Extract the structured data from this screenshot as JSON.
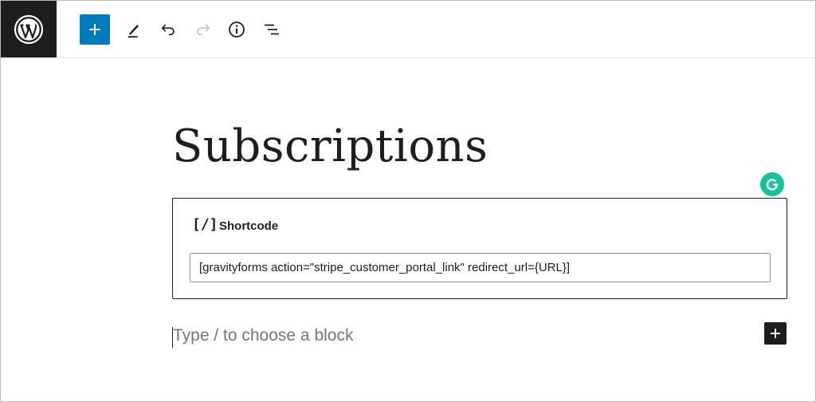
{
  "toolbar": {
    "logo_icon": "wordpress-logo-icon",
    "add_block_icon": "plus-icon",
    "tools_icon": "pencil-icon",
    "undo_icon": "undo-icon",
    "redo_icon": "redo-icon",
    "details_icon": "info-icon",
    "list_view_icon": "list-view-icon",
    "accent_color": "#007cba"
  },
  "editor": {
    "post_title": "Subscriptions",
    "shortcode_block": {
      "icon_text": "[/]",
      "label": "Shortcode",
      "value": "[gravityforms action=\"stripe_customer_portal_link\" redirect_url={URL}]"
    },
    "default_block_placeholder": "Type / to choose a block",
    "inserter_icon": "plus-icon",
    "grammarly_icon": "grammarly-icon",
    "grammarly_color": "#15c39a"
  }
}
